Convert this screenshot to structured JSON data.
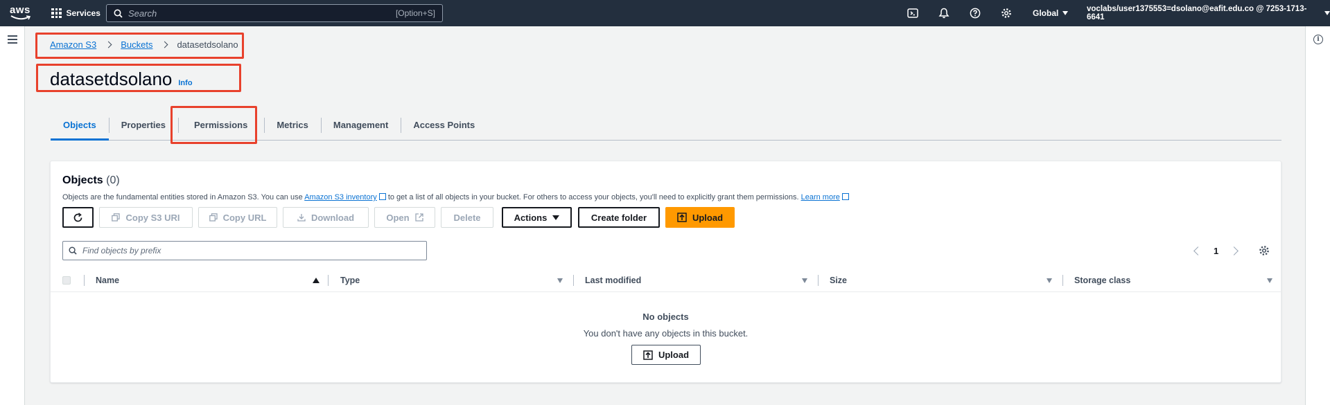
{
  "nav": {
    "logo_text": "aws",
    "services_label": "Services",
    "search_placeholder": "Search",
    "search_shortcut": "[Option+S]",
    "region": "Global",
    "account": "voclabs/user1375553=dsolano@eafit.edu.co @ 7253-1713-6641"
  },
  "breadcrumb": {
    "items": [
      "Amazon S3",
      "Buckets"
    ],
    "current": "datasetdsolano"
  },
  "page": {
    "title": "datasetdsolano",
    "info_link": "Info"
  },
  "tabs": [
    "Objects",
    "Properties",
    "Permissions",
    "Metrics",
    "Management",
    "Access Points"
  ],
  "objects": {
    "title": "Objects",
    "count": "(0)",
    "description_pre": "Objects are the fundamental entities stored in Amazon S3. You can use",
    "inventory_link": "Amazon S3 inventory",
    "description_mid": "to get a list of all objects in your bucket. For others to access your objects, you'll need to explicitly grant them permissions.",
    "learn_more": "Learn more",
    "buttons": {
      "copy_s3_uri": "Copy S3 URI",
      "copy_url": "Copy URL",
      "download": "Download",
      "open": "Open",
      "delete": "Delete",
      "actions": "Actions",
      "create_folder": "Create folder",
      "upload": "Upload"
    },
    "filter_placeholder": "Find objects by prefix",
    "page_number": "1",
    "columns": [
      "Name",
      "Type",
      "Last modified",
      "Size",
      "Storage class"
    ],
    "empty_title": "No objects",
    "empty_subtitle": "You don't have any objects in this bucket.",
    "empty_upload": "Upload"
  },
  "colors": {
    "nav_bg": "#232f3e",
    "link": "#0972d3",
    "primary_button": "#ff9900",
    "highlight_box": "#e8412c"
  }
}
